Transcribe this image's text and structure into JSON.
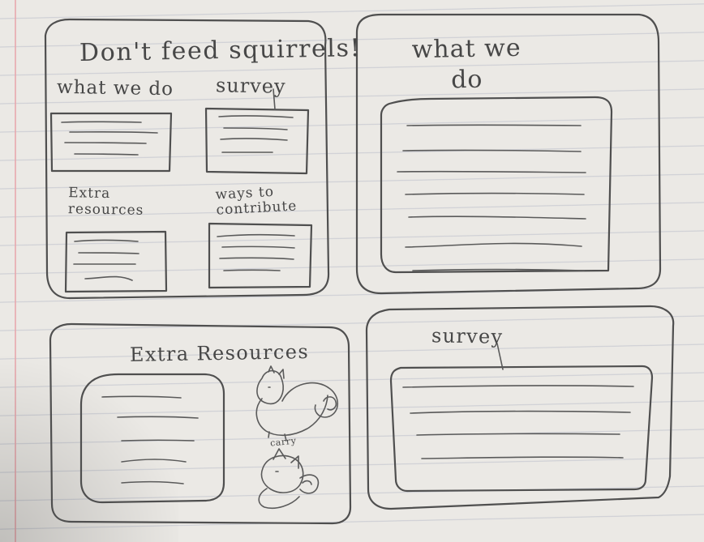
{
  "paper": {
    "line_color": "#c9cbd2",
    "margin_line_color": "#e7a7ad",
    "pencil_color": "#4f4f4f"
  },
  "home_frame": {
    "title": "Don't feed squirrels!",
    "sections": {
      "what_we_do": "what we do",
      "survey": "survey",
      "extra_resources": "Extra\nresources",
      "ways_to_contribute": "ways to\ncontribute"
    }
  },
  "what_we_do_frame": {
    "title": "what we\ndo"
  },
  "extra_resources_frame": {
    "title": "Extra Resources",
    "squirrel_caption": "carry"
  },
  "survey_frame": {
    "title": "survey"
  },
  "icons": {
    "squirrel_top": "squirrel-icon",
    "squirrel_bottom": "squirrel-carrying-icon",
    "text_lines": "text-lines-icon"
  }
}
